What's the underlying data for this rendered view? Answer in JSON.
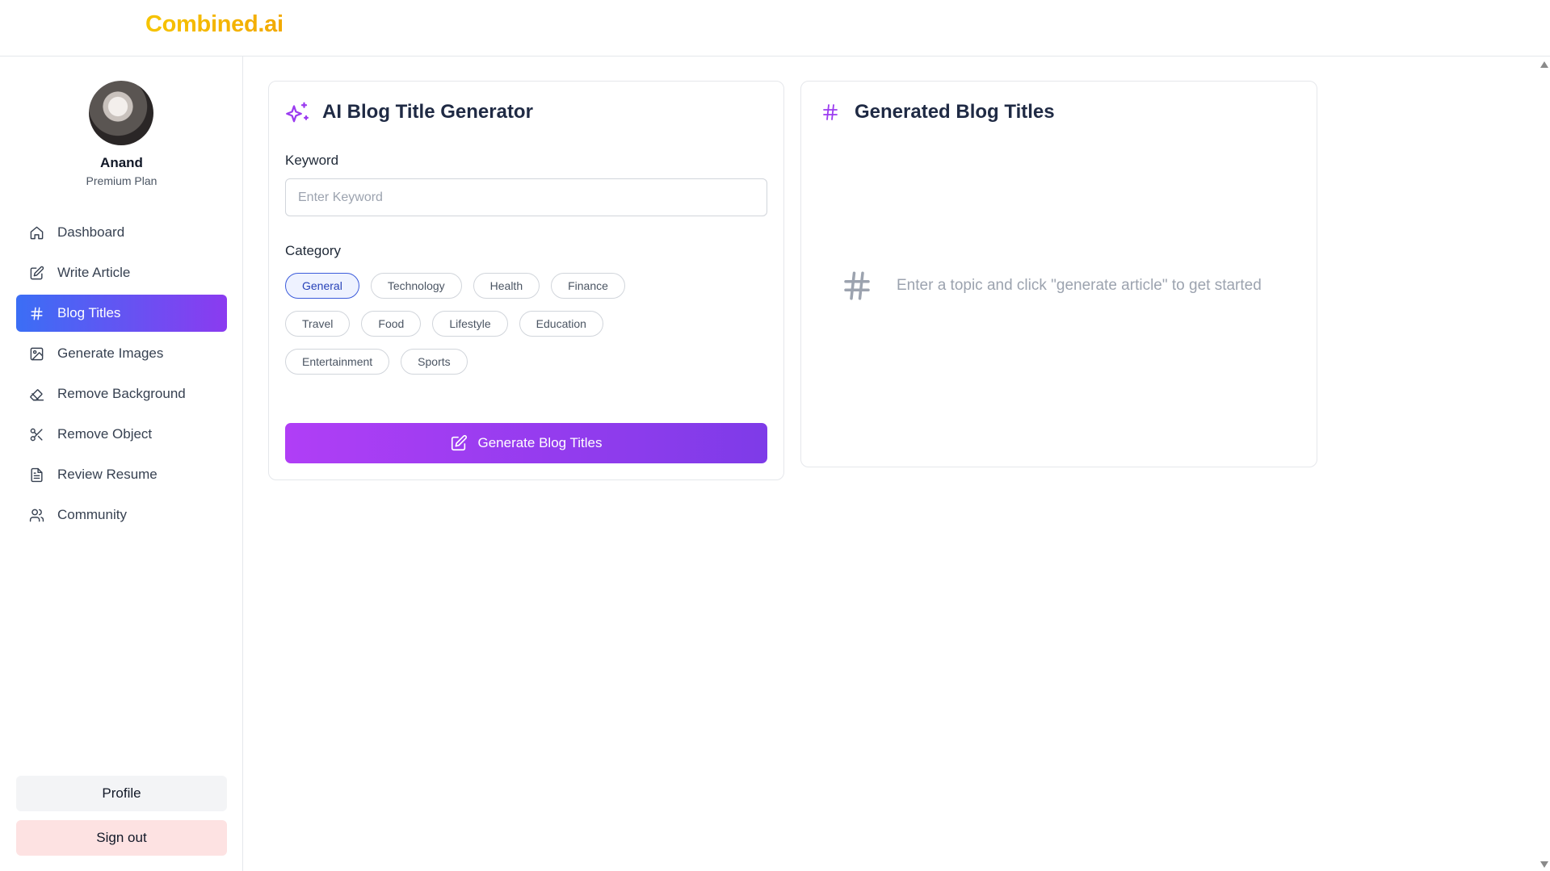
{
  "app": {
    "logo": "Combined.ai"
  },
  "user": {
    "name": "Anand",
    "plan": "Premium Plan"
  },
  "sidebar": {
    "items": [
      {
        "label": "Dashboard",
        "icon": "home-icon"
      },
      {
        "label": "Write Article",
        "icon": "edit-icon"
      },
      {
        "label": "Blog Titles",
        "icon": "hash-icon",
        "active": true
      },
      {
        "label": "Generate Images",
        "icon": "image-icon"
      },
      {
        "label": "Remove Background",
        "icon": "eraser-icon"
      },
      {
        "label": "Remove Object",
        "icon": "scissors-icon"
      },
      {
        "label": "Review Resume",
        "icon": "file-text-icon"
      },
      {
        "label": "Community",
        "icon": "users-icon"
      }
    ],
    "profile_label": "Profile",
    "signout_label": "Sign out"
  },
  "generator": {
    "title": "AI Blog Title Generator",
    "icon": "sparkles-icon",
    "keyword_label": "Keyword",
    "keyword_placeholder": "Enter Keyword",
    "keyword_value": "",
    "category_label": "Category",
    "categories": [
      "General",
      "Technology",
      "Health",
      "Finance",
      "Travel",
      "Food",
      "Lifestyle",
      "Education",
      "Entertainment",
      "Sports"
    ],
    "selected_category": "General",
    "button_label": "Generate Blog Titles"
  },
  "results": {
    "title": "Generated Blog Titles",
    "icon": "hash-icon",
    "empty_text": "Enter a topic and click \"generate article\" to get started"
  },
  "colors": {
    "accent_start": "#3b6ef5",
    "accent_end": "#8b3bf0",
    "button_start": "#b03ef6",
    "button_end": "#7e3be8",
    "logo": "#f6c400",
    "signout_bg": "#fde2e2"
  }
}
